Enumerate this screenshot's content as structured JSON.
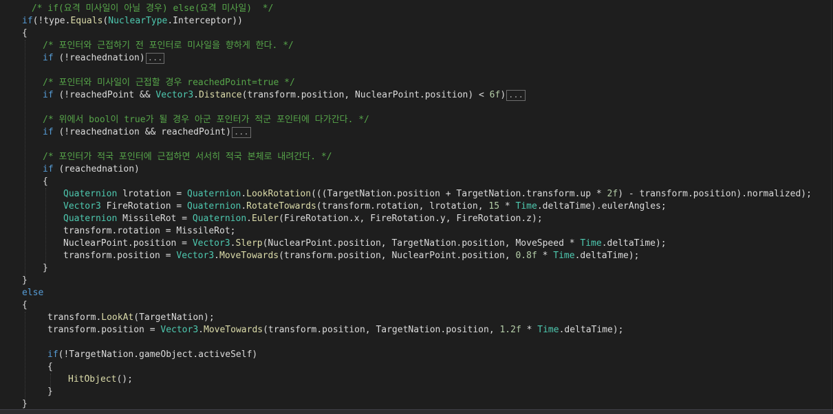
{
  "editor": {
    "language": "C#",
    "theme": {
      "background": "#1e1e1e",
      "keyword": "#569cd6",
      "type": "#4ec9b0",
      "method": "#dcdcaa",
      "comment": "#57a64a",
      "number": "#b5cea8",
      "identifier": "#dcdcdc"
    },
    "lines": [
      [
        [
          "cm",
          " /* if(요격 미사일이 아닐 경우) else(요격 미사일)  */"
        ]
      ],
      [
        [
          "kw",
          "if"
        ],
        [
          "plain",
          "(!type."
        ],
        [
          "fn",
          "Equals"
        ],
        [
          "plain",
          "("
        ],
        [
          "cls",
          "NuclearType"
        ],
        [
          "plain",
          ".Interceptor))"
        ]
      ],
      [
        [
          "plain",
          "{"
        ]
      ],
      [
        [
          "cm",
          "/* 포인터와 근접하기 전 포인터로 미사일을 향하게 한다. */"
        ]
      ],
      [
        [
          "kw",
          "if"
        ],
        [
          "plain",
          " (!reachednation)"
        ],
        [
          "fold",
          "..."
        ]
      ],
      [],
      [
        [
          "cm",
          "/* 포인터와 미사일이 근접할 경우 reachedPoint=true */"
        ]
      ],
      [
        [
          "kw",
          "if"
        ],
        [
          "plain",
          " (!reachedPoint && "
        ],
        [
          "cls",
          "Vector3"
        ],
        [
          "plain",
          "."
        ],
        [
          "fn",
          "Distance"
        ],
        [
          "plain",
          "(transform.position, NuclearPoint.position) < "
        ],
        [
          "num",
          "6f"
        ],
        [
          "plain",
          ")"
        ],
        [
          "fold",
          "..."
        ]
      ],
      [],
      [
        [
          "cm",
          "/* 위에서 bool이 true가 될 경우 아군 포인터가 적군 포인터에 다가간다. */"
        ]
      ],
      [
        [
          "kw",
          "if"
        ],
        [
          "plain",
          " (!reachednation && reachedPoint)"
        ],
        [
          "fold",
          "..."
        ]
      ],
      [],
      [
        [
          "cm",
          "/* 포인터가 적국 포인터에 근접하면 서서히 적국 본체로 내려간다. */"
        ]
      ],
      [
        [
          "kw",
          "if"
        ],
        [
          "plain",
          " (reachednation)"
        ]
      ],
      [
        [
          "plain",
          "{"
        ]
      ],
      [
        [
          "cls",
          "Quaternion"
        ],
        [
          "plain",
          " "
        ],
        [
          "id",
          "lrotation"
        ],
        [
          "plain",
          " = "
        ],
        [
          "cls",
          "Quaternion"
        ],
        [
          "plain",
          "."
        ],
        [
          "fn",
          "LookRotation"
        ],
        [
          "plain",
          "(((TargetNation.position + TargetNation.transform.up * "
        ],
        [
          "num",
          "2f"
        ],
        [
          "plain",
          ") - transform.position).normalized);"
        ]
      ],
      [
        [
          "cls",
          "Vector3"
        ],
        [
          "plain",
          " "
        ],
        [
          "id",
          "FireRotation"
        ],
        [
          "plain",
          " = "
        ],
        [
          "cls",
          "Quaternion"
        ],
        [
          "plain",
          "."
        ],
        [
          "fn",
          "RotateTowards"
        ],
        [
          "plain",
          "(transform.rotation, "
        ],
        [
          "id",
          "lrotation"
        ],
        [
          "plain",
          ", "
        ],
        [
          "num",
          "15"
        ],
        [
          "plain",
          " * "
        ],
        [
          "cls",
          "Time"
        ],
        [
          "plain",
          ".deltaTime).eulerAngles;"
        ]
      ],
      [
        [
          "cls",
          "Quaternion"
        ],
        [
          "plain",
          " "
        ],
        [
          "id",
          "MissileRot"
        ],
        [
          "plain",
          " = "
        ],
        [
          "cls",
          "Quaternion"
        ],
        [
          "plain",
          "."
        ],
        [
          "fn",
          "Euler"
        ],
        [
          "plain",
          "("
        ],
        [
          "id",
          "FireRotation"
        ],
        [
          "plain",
          ".x, "
        ],
        [
          "id",
          "FireRotation"
        ],
        [
          "plain",
          ".y, "
        ],
        [
          "id",
          "FireRotation"
        ],
        [
          "plain",
          ".z);"
        ]
      ],
      [
        [
          "plain",
          "transform.rotation = "
        ],
        [
          "id",
          "MissileRot"
        ],
        [
          "plain",
          ";"
        ]
      ],
      [
        [
          "plain",
          "NuclearPoint.position = "
        ],
        [
          "cls",
          "Vector3"
        ],
        [
          "plain",
          "."
        ],
        [
          "fn",
          "Slerp"
        ],
        [
          "plain",
          "(NuclearPoint.position, TargetNation.position, MoveSpeed * "
        ],
        [
          "cls",
          "Time"
        ],
        [
          "plain",
          ".deltaTime);"
        ]
      ],
      [
        [
          "plain",
          "transform.position = "
        ],
        [
          "cls",
          "Vector3"
        ],
        [
          "plain",
          "."
        ],
        [
          "fn",
          "MoveTowards"
        ],
        [
          "plain",
          "(transform.position, NuclearPoint.position, "
        ],
        [
          "num",
          "0.8f"
        ],
        [
          "plain",
          " * "
        ],
        [
          "cls",
          "Time"
        ],
        [
          "plain",
          ".deltaTime);"
        ]
      ],
      [
        [
          "plain",
          "}"
        ]
      ],
      [
        [
          "plain",
          "}"
        ]
      ],
      [
        [
          "kw",
          "else"
        ]
      ],
      [
        [
          "plain",
          "{"
        ]
      ],
      [
        [
          "plain",
          "transform."
        ],
        [
          "fn",
          "LookAt"
        ],
        [
          "plain",
          "(TargetNation);"
        ]
      ],
      [
        [
          "plain",
          "transform.position = "
        ],
        [
          "cls",
          "Vector3"
        ],
        [
          "plain",
          "."
        ],
        [
          "fn",
          "MoveTowards"
        ],
        [
          "plain",
          "(transform.position, TargetNation.position, "
        ],
        [
          "num",
          "1.2f"
        ],
        [
          "plain",
          " * "
        ],
        [
          "cls",
          "Time"
        ],
        [
          "plain",
          ".deltaTime);"
        ]
      ],
      [],
      [
        [
          "kw",
          "if"
        ],
        [
          "plain",
          "(!TargetNation.gameObject.activeSelf)"
        ]
      ],
      [
        [
          "plain",
          "{"
        ]
      ],
      [
        [
          "fn",
          "HitObject"
        ],
        [
          "plain",
          "();"
        ]
      ],
      [
        [
          "plain",
          "}"
        ]
      ],
      [
        [
          "plain",
          "}"
        ]
      ]
    ]
  }
}
